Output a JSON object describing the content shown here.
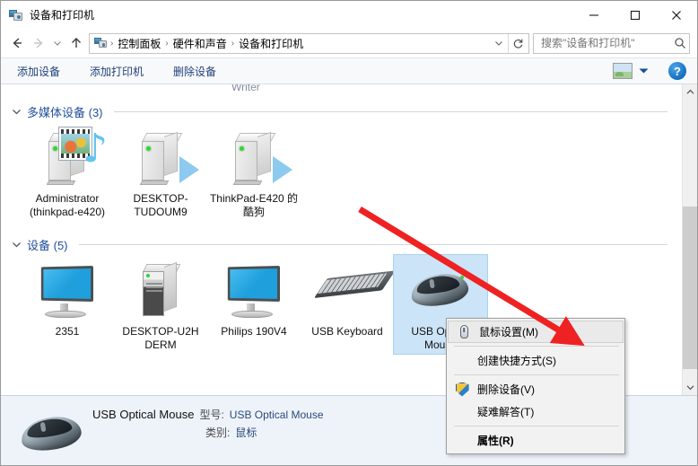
{
  "window": {
    "title": "设备和打印机",
    "title_icon": "devices-printers-icon",
    "minimize_label": "最小化",
    "maximize_label": "最大化",
    "close_label": "关闭"
  },
  "addressbar": {
    "back_icon": "back-arrow-icon",
    "forward_icon": "forward-arrow-icon",
    "recent_icon": "chevron-down-icon",
    "up_icon": "up-arrow-icon",
    "crumb_icon": "devices-printers-icon",
    "breadcrumbs": [
      "控制面板",
      "硬件和声音",
      "设备和打印机"
    ],
    "separator": "›",
    "dropdown_icon": "chevron-down-icon",
    "refresh_icon": "refresh-icon"
  },
  "search": {
    "placeholder": "搜索\"设备和打印机\"",
    "value": "",
    "icon": "search-icon"
  },
  "toolbar": {
    "items": [
      {
        "label": "添加设备",
        "name": "add-device-button"
      },
      {
        "label": "添加打印机",
        "name": "add-printer-button"
      },
      {
        "label": "删除设备",
        "name": "remove-device-button"
      }
    ],
    "view_icon": "view-options-icon",
    "view_caret_icon": "chevron-down-icon",
    "help_label": "?",
    "help_icon": "help-icon"
  },
  "content": {
    "clipped_label": "Writer",
    "groups": [
      {
        "name": "multimedia-devices",
        "title": "多媒体设备 (3)",
        "chevron": "chevron-down-icon",
        "items": [
          {
            "label": "Administrator (thinkpad-e420)",
            "art": "media-server-icon",
            "selected": false
          },
          {
            "label": "DESKTOP-TUDOUM9",
            "art": "media-tower-icon",
            "selected": false
          },
          {
            "label": "ThinkPad-E420 的酷狗",
            "art": "media-tower-icon",
            "selected": false
          }
        ]
      },
      {
        "name": "devices",
        "title": "设备 (5)",
        "chevron": "chevron-down-icon",
        "items": [
          {
            "label": "2351",
            "art": "monitor-icon",
            "selected": false
          },
          {
            "label": "DESKTOP-U2H DERM",
            "art": "desktop-pc-icon",
            "selected": false
          },
          {
            "label": "Philips 190V4",
            "art": "monitor-icon",
            "selected": false
          },
          {
            "label": "USB Keyboard",
            "art": "keyboard-icon",
            "selected": false
          },
          {
            "label": "USB Optical Mouse",
            "art": "mouse-icon",
            "selected": true
          }
        ]
      }
    ]
  },
  "scrollbar": {
    "up_icon": "chevron-up-icon",
    "down_icon": "chevron-down-icon"
  },
  "statusbar": {
    "icon": "mouse-icon",
    "device_name": "USB Optical Mouse",
    "fields": [
      {
        "label": "型号:",
        "value": "USB Optical Mouse"
      },
      {
        "label": "类别:",
        "value": "鼠标"
      }
    ]
  },
  "context_menu": {
    "items": [
      {
        "label": "鼠标设置(M)",
        "icon": "mouse-icon",
        "highlighted": true,
        "bold": false,
        "name": "mouse-settings"
      },
      {
        "label": "创建快捷方式(S)",
        "icon": null,
        "highlighted": false,
        "bold": false,
        "name": "create-shortcut"
      },
      {
        "label": "删除设备(V)",
        "icon": "shield-icon",
        "highlighted": false,
        "bold": false,
        "name": "remove-device"
      },
      {
        "label": "疑难解答(T)",
        "icon": null,
        "highlighted": false,
        "bold": false,
        "name": "troubleshoot"
      },
      {
        "label": "属性(R)",
        "icon": null,
        "highlighted": false,
        "bold": true,
        "name": "properties"
      }
    ]
  },
  "annotation": {
    "arrow_color": "#ee2222",
    "name": "red-pointer-arrow"
  }
}
